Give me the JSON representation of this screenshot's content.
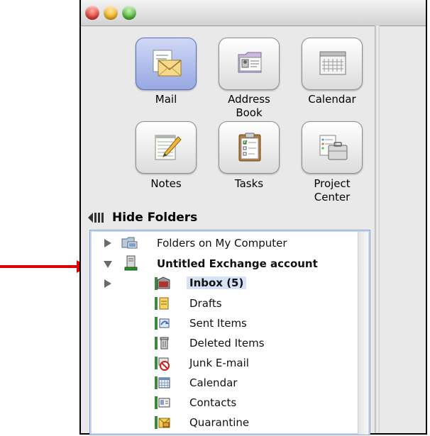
{
  "toolbar": {
    "buttons": [
      {
        "id": "mail",
        "label": "Mail",
        "icon": "mail-envelope-icon",
        "selected": true
      },
      {
        "id": "address-book",
        "label": "Address\nBook",
        "icon": "address-book-icon",
        "selected": false
      },
      {
        "id": "calendar",
        "label": "Calendar",
        "icon": "calendar-icon",
        "selected": false
      },
      {
        "id": "notes",
        "label": "Notes",
        "icon": "notes-pad-icon",
        "selected": false
      },
      {
        "id": "tasks",
        "label": "Tasks",
        "icon": "clipboard-tasks-icon",
        "selected": false
      },
      {
        "id": "project-center",
        "label": "Project\nCenter",
        "icon": "project-briefcase-icon",
        "selected": false
      }
    ]
  },
  "hide_folders": {
    "label": "Hide Folders",
    "icon": "hide-folders-icon"
  },
  "folders": {
    "items": [
      {
        "label": "Folders on My Computer",
        "icon": "computer-folder-icon",
        "disclosure": "collapsed",
        "bold": false
      },
      {
        "label": "Untitled Exchange account",
        "icon": "exchange-server-icon",
        "disclosure": "expanded",
        "bold": true
      },
      {
        "label": "Inbox (5)",
        "icon": "inbox-icon",
        "disclosure": "collapsed",
        "bold": true,
        "selected": true
      },
      {
        "label": "Drafts",
        "icon": "drafts-icon"
      },
      {
        "label": "Sent Items",
        "icon": "sent-items-icon"
      },
      {
        "label": "Deleted Items",
        "icon": "deleted-items-icon"
      },
      {
        "label": "Junk E-mail",
        "icon": "junk-mail-icon"
      },
      {
        "label": "Calendar",
        "icon": "calendar-folder-icon"
      },
      {
        "label": "Contacts",
        "icon": "contacts-folder-icon"
      },
      {
        "label": "Quarantine",
        "icon": "quarantine-folder-icon"
      }
    ]
  },
  "colors": {
    "selected_row": "#d6e2f6",
    "annotation_arrow": "#e00000",
    "pane_border": "#8aa7d0"
  }
}
